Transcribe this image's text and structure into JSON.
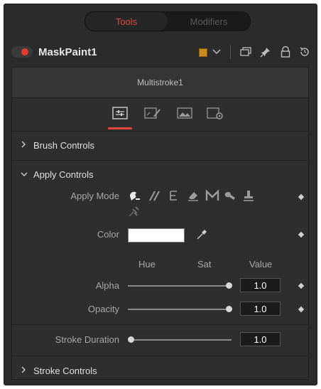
{
  "tabs": {
    "tools": "Tools",
    "modifiers": "Modifiers"
  },
  "header": {
    "node_name": "MaskPaint1",
    "swatch_color": "#c98b1e",
    "icons": [
      "chevron-down-icon",
      "copy-icon",
      "pin-icon",
      "lock-icon",
      "reset-icon"
    ]
  },
  "subtitle": "Multistroke1",
  "icon_tabs": [
    "controls-tab-icon",
    "paint-tab-icon",
    "image-tab-icon",
    "settings-tab-icon"
  ],
  "sections": {
    "brush": {
      "label": "Brush Controls",
      "expanded": false
    },
    "apply": {
      "label": "Apply Controls",
      "expanded": true
    },
    "stroke": {
      "label": "Stroke Controls",
      "expanded": false
    }
  },
  "apply": {
    "mode_label": "Apply Mode",
    "modes": [
      "color-mode-icon",
      "clone-mode-icon",
      "emboss-mode-icon",
      "erase-mode-icon",
      "merge-mode-icon",
      "smear-mode-icon",
      "stamp-mode-icon",
      "wire-mode-icon"
    ],
    "color_label": "Color",
    "color_value": "#ffffff",
    "col_hue": "Hue",
    "col_sat": "Sat",
    "col_value": "Value",
    "alpha_label": "Alpha",
    "alpha_value": "1.0",
    "alpha_fraction": 1.0,
    "opacity_label": "Opacity",
    "opacity_value": "1.0",
    "opacity_fraction": 1.0
  },
  "stroke_duration": {
    "label": "Stroke Duration",
    "value": "1.0",
    "fraction": 0.0
  },
  "colors": {
    "accent": "#e0463a",
    "record": "#e23b2e"
  }
}
